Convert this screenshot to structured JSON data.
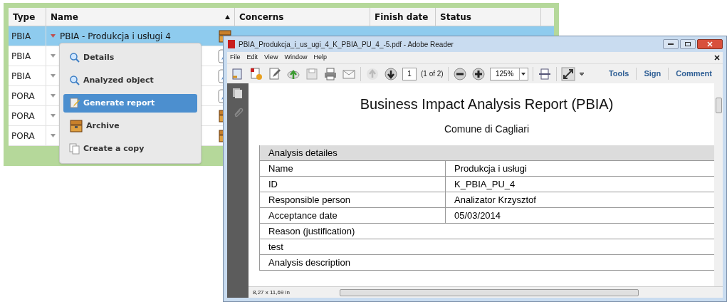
{
  "table": {
    "columns": [
      {
        "label": "Type",
        "sort": false
      },
      {
        "label": "Name",
        "sort": true
      },
      {
        "label": "Concerns",
        "sort": false
      },
      {
        "label": "Finish date",
        "sort": false
      },
      {
        "label": "Status",
        "sort": false
      }
    ],
    "rows": [
      {
        "type": "PBIA",
        "name": "PBIA - Produkcja i usługi 4",
        "kind": "archived",
        "selected": true
      },
      {
        "type": "PBIA",
        "kind": "editable",
        "selected": false
      },
      {
        "type": "PBIA",
        "kind": "editable",
        "selected": false
      },
      {
        "type": "PORA",
        "kind": "editable",
        "selected": false
      },
      {
        "type": "PORA",
        "kind": "archived",
        "selected": false
      },
      {
        "type": "PORA",
        "kind": "archived",
        "selected": false
      }
    ]
  },
  "context_menu": [
    {
      "label": "Details",
      "kind": "view",
      "selected": false
    },
    {
      "label": "Analyzed object",
      "kind": "view",
      "selected": false
    },
    {
      "label": "Generate report",
      "kind": "report",
      "selected": true
    },
    {
      "label": "Archive",
      "kind": "archive",
      "selected": false
    },
    {
      "label": "Create a copy",
      "kind": "copy",
      "selected": false
    }
  ],
  "reader": {
    "title": "PBIA_Produkcja_i_us_ugi_4_K_PBIA_PU_4_-5.pdf - Adobe Reader",
    "menu": [
      "File",
      "Edit",
      "View",
      "Window",
      "Help"
    ],
    "page": "1",
    "page_count": "(1 of 2)",
    "zoom": "125%",
    "tools": [
      "Tools",
      "Sign",
      "Comment"
    ],
    "document": {
      "title": "Business Impact Analysis Report (PBIA)",
      "subtitle": "Comune di Cagliari",
      "rows": [
        {
          "kind": "section",
          "cells": [
            "Analysis detailes"
          ]
        },
        {
          "kind": "pair",
          "cells": [
            "Name",
            "Produkcja i usługi"
          ]
        },
        {
          "kind": "pair",
          "cells": [
            "ID",
            "K_PBIA_PU_4"
          ]
        },
        {
          "kind": "pair",
          "cells": [
            "Responsible person",
            "Analizator Krzysztof"
          ]
        },
        {
          "kind": "pair",
          "cells": [
            "Acceptance date",
            "05/03/2014"
          ]
        },
        {
          "kind": "full",
          "cells": [
            "Reason (justification)"
          ]
        },
        {
          "kind": "full",
          "cells": [
            "test"
          ]
        },
        {
          "kind": "full",
          "cells": [
            "Analysis description"
          ]
        }
      ]
    },
    "page_size": "8,27 x 11,69 in"
  }
}
